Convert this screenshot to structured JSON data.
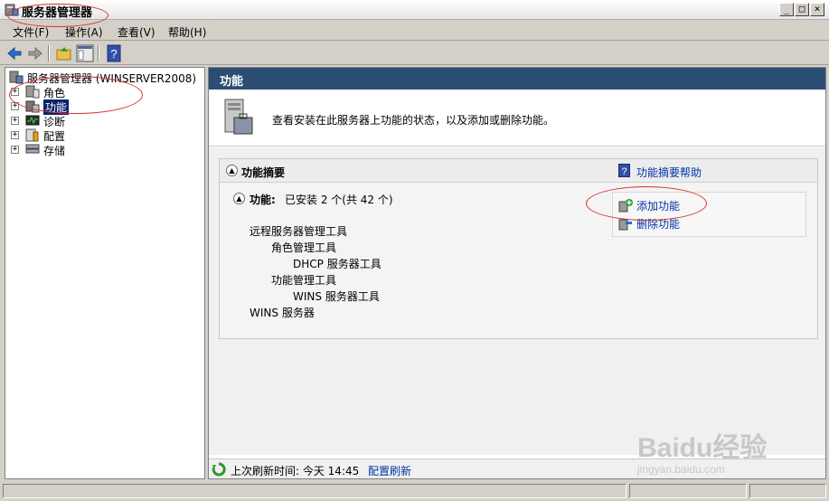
{
  "window": {
    "title": "服务器管理器",
    "min_label": "_",
    "max_label": "□",
    "close_label": "×"
  },
  "menu": [
    "文件(F)",
    "操作(A)",
    "查看(V)",
    "帮助(H)"
  ],
  "tree": {
    "root": "服务器管理器 (WINSERVER2008)",
    "items": [
      {
        "label": "角色",
        "icon": "roles-icon"
      },
      {
        "label": "功能",
        "icon": "features-icon"
      },
      {
        "label": "诊断",
        "icon": "diagnostics-icon"
      },
      {
        "label": "配置",
        "icon": "configuration-icon"
      },
      {
        "label": "存储",
        "icon": "storage-icon"
      }
    ],
    "expander": "+"
  },
  "main": {
    "header": "功能",
    "intro": "查看安装在此服务器上功能的状态，以及添加或删除功能。",
    "summary_title": "功能摘要",
    "summary_help": "功能摘要帮助",
    "features_label": "功能:",
    "features_status": "已安装 2 个(共 42 个)",
    "features": [
      {
        "name": "远程服务器管理工具",
        "level": 0
      },
      {
        "name": "角色管理工具",
        "level": 1
      },
      {
        "name": "DHCP 服务器工具",
        "level": 2
      },
      {
        "name": "功能管理工具",
        "level": 1
      },
      {
        "name": "WINS 服务器工具",
        "level": 2
      },
      {
        "name": "WINS 服务器",
        "level": 0
      }
    ],
    "add_feature": "添加功能",
    "remove_feature": "删除功能",
    "refresh_label": "上次刷新时间: 今天 14:45",
    "refresh_link": "配置刷新"
  },
  "watermark": {
    "brand": "Baidu经验",
    "url": "jingyan.baidu.com"
  },
  "colors": {
    "header_bg": "#2c4d73",
    "link": "#0033aa",
    "annotation": "#d43030"
  }
}
